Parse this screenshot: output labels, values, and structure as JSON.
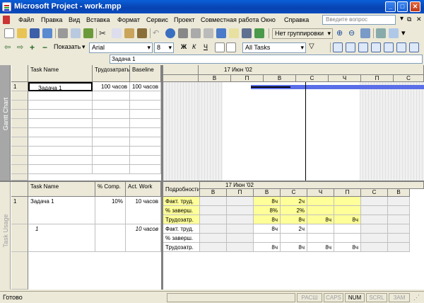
{
  "window": {
    "title": "Microsoft Project - work.mpp"
  },
  "menu": {
    "items": [
      "Файл",
      "Правка",
      "Вид",
      "Вставка",
      "Формат",
      "Сервис",
      "Проект",
      "Совместная работа",
      "Окно",
      "Справка"
    ],
    "ask_placeholder": "Введите вопрос"
  },
  "toolbar1": {
    "grouping": "Нет группировки"
  },
  "toolbar2": {
    "show_label": "Показать",
    "font": "Arial",
    "font_size": "8",
    "bold": "Ж",
    "italic": "К",
    "underline": "Ч",
    "filter": "All Tasks"
  },
  "entry": {
    "value": "Задача 1"
  },
  "top_view": {
    "label": "Gantt Chart",
    "columns": [
      "Task Name",
      "Трудозатраты",
      "Baseline"
    ],
    "rows": [
      {
        "num": "1",
        "name": "Задача 1",
        "work": "100 часов",
        "baseline": "100 часов"
      }
    ],
    "timescale": {
      "week": "17 Июн '02",
      "days": [
        "В",
        "П",
        "В",
        "С",
        "Ч",
        "П",
        "С"
      ]
    }
  },
  "bottom_view": {
    "label": "Task Usage",
    "columns": [
      "Task Name",
      "% Comp.",
      "Act. Work"
    ],
    "rows": [
      {
        "num": "1",
        "name": "Задача 1",
        "comp": "10%",
        "act": "10 часов"
      },
      {
        "num": "",
        "name": "1",
        "comp": "",
        "act": "10 часов"
      }
    ],
    "detail_header": "Подробности",
    "timescale": {
      "week": "17 Июн '02",
      "days": [
        "В",
        "П",
        "В",
        "С",
        "Ч",
        "П",
        "С",
        "В"
      ]
    },
    "details": [
      {
        "label": "Факт. труд.",
        "values": [
          "",
          "",
          "8ч",
          "2ч",
          "",
          "",
          "",
          ""
        ]
      },
      {
        "label": "% заверш.",
        "values": [
          "",
          "",
          "8%",
          "2%",
          "",
          "",
          "",
          ""
        ]
      },
      {
        "label": "Трудозатр.",
        "values": [
          "",
          "",
          "8ч",
          "8ч",
          "8ч",
          "8ч",
          "",
          ""
        ]
      },
      {
        "label": "Факт. труд.",
        "values": [
          "",
          "",
          "8ч",
          "2ч",
          "",
          "",
          "",
          ""
        ]
      },
      {
        "label": "% заверш.",
        "values": [
          "",
          "",
          "",
          "",
          "",
          "",
          "",
          ""
        ]
      },
      {
        "label": "Трудозатр.",
        "values": [
          "",
          "",
          "8ч",
          "8ч",
          "8ч",
          "8ч",
          "",
          ""
        ]
      }
    ]
  },
  "status": {
    "text": "Готово",
    "indicators": [
      "РАСШ",
      "CAPS",
      "NUM",
      "SCRL",
      "ЗАМ"
    ]
  }
}
